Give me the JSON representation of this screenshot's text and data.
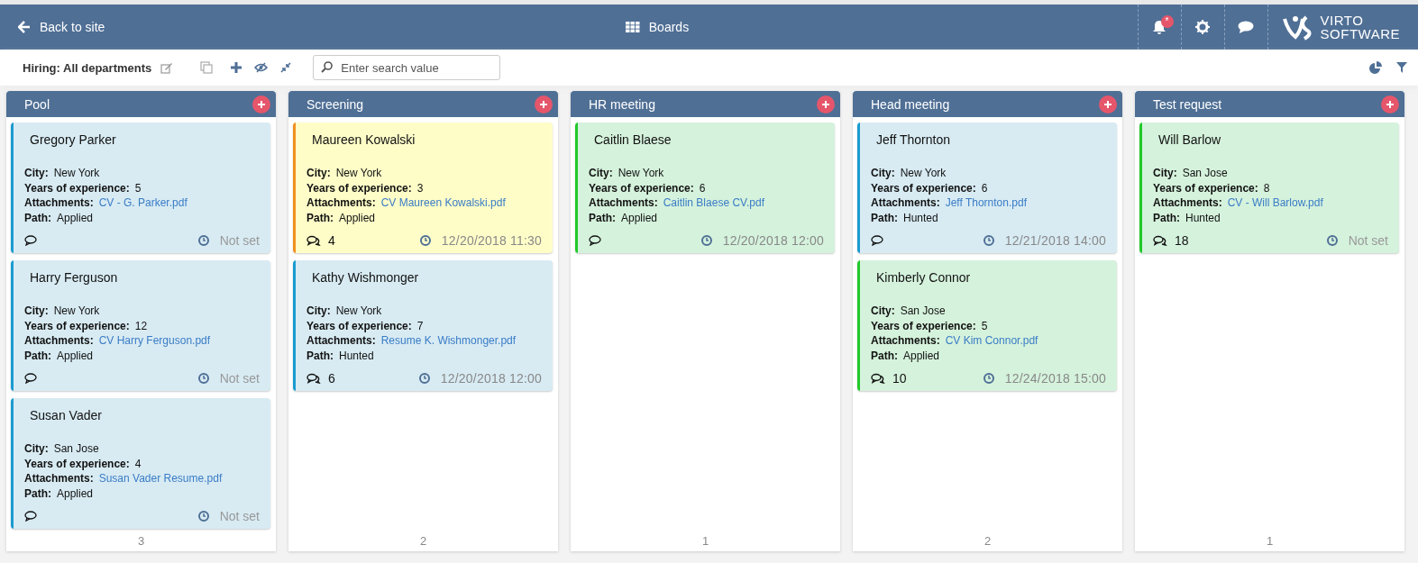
{
  "topbar": {
    "back_label": "Back to site",
    "title": "Boards",
    "notification_badge": "*",
    "logo_line1": "VIRTO",
    "logo_line2": "SOFTWARE"
  },
  "toolbar": {
    "board_name": "Hiring: All departments",
    "search": {
      "placeholder": "Enter search value"
    }
  },
  "columns": [
    {
      "title": "Pool",
      "count": "3",
      "cards": [
        {
          "name": "Gregory Parker",
          "color": "#1a9bd0",
          "fields": [
            {
              "label": "City:",
              "value": "New York"
            },
            {
              "label": "Years of experience:",
              "value": "5"
            },
            {
              "label": "Attachments:",
              "value": "CV - G. Parker.pdf",
              "kind": "link"
            },
            {
              "label": "Path:",
              "value": "Applied"
            }
          ],
          "due": "Not set",
          "due_set": false
        },
        {
          "name": "Harry Ferguson",
          "color": "#1a9bd0",
          "fields": [
            {
              "label": "City:",
              "value": "New York"
            },
            {
              "label": "Years of experience:",
              "value": "12"
            },
            {
              "label": "Attachments:",
              "value": "CV Harry Ferguson.pdf",
              "kind": "link"
            },
            {
              "label": "Path:",
              "value": "Applied"
            }
          ],
          "due": "Not set",
          "due_set": false
        },
        {
          "name": "Susan Vader",
          "color": "#1a9bd0",
          "fields": [
            {
              "label": "City:",
              "value": "San Jose"
            },
            {
              "label": "Years of experience:",
              "value": "4"
            },
            {
              "label": "Attachments:",
              "value": "Susan Vader Resume.pdf",
              "kind": "link"
            },
            {
              "label": "Path:",
              "value": "Applied"
            }
          ],
          "due": "Not set",
          "due_set": false
        }
      ]
    },
    {
      "title": "Screening",
      "count": "2",
      "cards": [
        {
          "name": "Maureen Kowalski",
          "color": "#f0901e",
          "fields": [
            {
              "label": "City:",
              "value": "New York"
            },
            {
              "label": "Years of experience:",
              "value": "3"
            },
            {
              "label": "Attachments:",
              "value": "CV Maureen Kowalski.pdf",
              "kind": "link"
            },
            {
              "label": "Path:",
              "value": "Applied"
            }
          ],
          "comments": "4",
          "due": "12/20/2018 11:30",
          "due_set": true
        },
        {
          "name": "Kathy Wishmonger",
          "color": "#1a9bd0",
          "fields": [
            {
              "label": "City:",
              "value": "New York"
            },
            {
              "label": "Years of experience:",
              "value": "7"
            },
            {
              "label": "Attachments:",
              "value": "Resume K. Wishmonger.pdf",
              "kind": "link"
            },
            {
              "label": "Path:",
              "value": "Hunted"
            }
          ],
          "comments": "6",
          "due": "12/20/2018 12:00",
          "due_set": true
        }
      ]
    },
    {
      "title": "HR meeting",
      "count": "1",
      "cards": [
        {
          "name": "Caitlin Blaese",
          "color": "#22c92a",
          "fields": [
            {
              "label": "City:",
              "value": "New York"
            },
            {
              "label": "Years of experience:",
              "value": "6"
            },
            {
              "label": "Attachments:",
              "value": "Caitlin Blaese CV.pdf",
              "kind": "link"
            },
            {
              "label": "Path:",
              "value": "Applied"
            }
          ],
          "due": "12/20/2018 12:00",
          "due_set": true
        }
      ]
    },
    {
      "title": "Head meeting",
      "count": "2",
      "cards": [
        {
          "name": "Jeff Thornton",
          "color": "#1a9bd0",
          "fields": [
            {
              "label": "City:",
              "value": "New York"
            },
            {
              "label": "Years of experience:",
              "value": "6"
            },
            {
              "label": "Attachments:",
              "value": "Jeff Thornton.pdf",
              "kind": "link"
            },
            {
              "label": "Path:",
              "value": "Hunted"
            }
          ],
          "due": "12/21/2018 14:00",
          "due_set": true
        },
        {
          "name": "Kimberly Connor",
          "color": "#22c92a",
          "fields": [
            {
              "label": "City:",
              "value": "San Jose"
            },
            {
              "label": "Years of experience:",
              "value": "5"
            },
            {
              "label": "Attachments:",
              "value": "CV Kim Connor.pdf",
              "kind": "link"
            },
            {
              "label": "Path:",
              "value": "Applied"
            }
          ],
          "comments": "10",
          "due": "12/24/2018 15:00",
          "due_set": true
        }
      ]
    },
    {
      "title": "Test request",
      "count": "1",
      "cards": [
        {
          "name": "Will Barlow",
          "color": "#22c92a",
          "fields": [
            {
              "label": "City:",
              "value": "San Jose"
            },
            {
              "label": "Years of experience:",
              "value": "8"
            },
            {
              "label": "Attachments:",
              "value": "CV - Will Barlow.pdf",
              "kind": "link"
            },
            {
              "label": "Path:",
              "value": "Hunted"
            }
          ],
          "comments": "18",
          "due": "Not set",
          "due_set": false
        }
      ]
    }
  ]
}
